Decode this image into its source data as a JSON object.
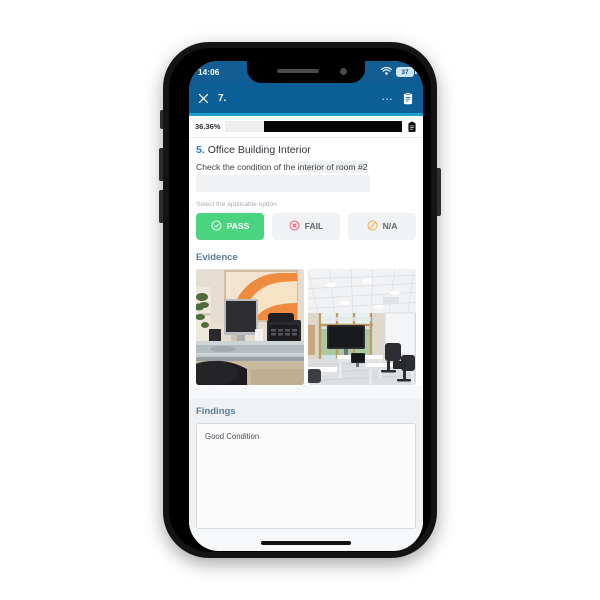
{
  "status_bar": {
    "time": "14:06",
    "wifi_icon": "wifi-icon",
    "battery_level": "37"
  },
  "app_bar": {
    "close_icon": "close-icon",
    "title": "7.",
    "overflow_menu": "...",
    "clipboard_icon": "clipboard-icon"
  },
  "progress": {
    "percent_label": "36.36%",
    "percent_value": 36.36,
    "fill_from_right_percent": 78,
    "clipboard_icon": "clipboard-icon"
  },
  "question": {
    "number": "5.",
    "title": "Office Building Interior",
    "prompt_lead": "Check the condition of the",
    "prompt_highlight": "interior of room #2"
  },
  "options": {
    "label": "Select the applicable option",
    "items": [
      {
        "id": "pass",
        "label": "PASS",
        "icon": "check-circle-icon",
        "selected": true,
        "color": "#4bd47f"
      },
      {
        "id": "fail",
        "label": "FAIL",
        "icon": "x-circle-icon",
        "selected": false,
        "color": "#ef4a6b"
      },
      {
        "id": "na",
        "label": "N/A",
        "icon": "no-entry-icon",
        "selected": false,
        "color": "#f5a33c"
      }
    ]
  },
  "evidence": {
    "title": "Evidence",
    "photos": [
      {
        "id": "photo-1",
        "alt": "Office desk with monitor, desk phone and orange wall art"
      },
      {
        "id": "photo-2",
        "alt": "Open plan office with wall mounted TV, windows and white desks"
      }
    ]
  },
  "findings": {
    "title": "Findings",
    "value": "Good Condition",
    "placeholder": ""
  },
  "theme": {
    "status_bar_bg": "#115d94",
    "app_bar_bg": "#0c5e96",
    "app_bar_underline": "#1d9fd0",
    "accent_blue": "#1b7fc4",
    "section_heading": "#5b7b94",
    "pass_green": "#4bd47f",
    "fail_red": "#ef4a6b",
    "na_orange": "#f5a33c"
  }
}
